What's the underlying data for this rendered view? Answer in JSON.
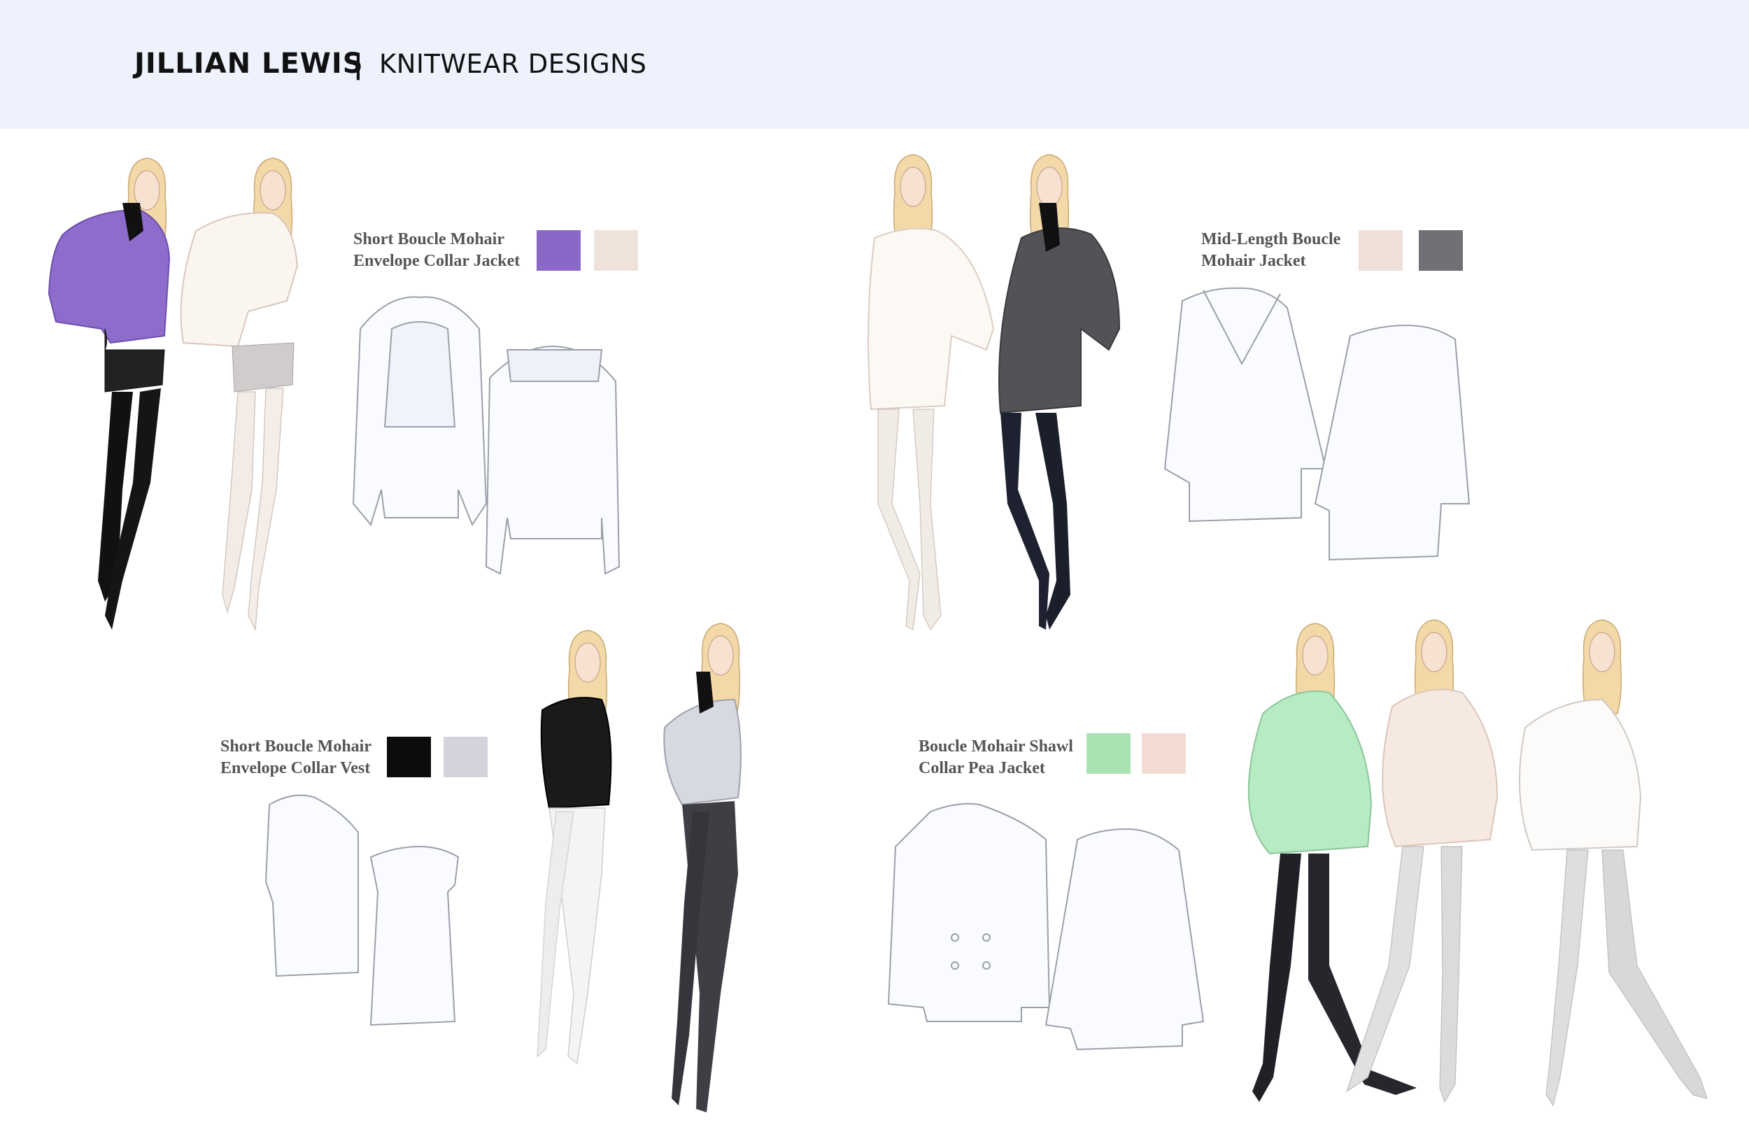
{
  "header": {
    "brand": "JILLIAN LEWIS",
    "separator": "|",
    "subtitle": "KNITWEAR DESIGNS"
  },
  "designs": [
    {
      "label_line1": "Short Boucle Mohair",
      "label_line2": "Envelope Collar Jacket",
      "swatches": [
        "#8a68c8",
        "#efe2db"
      ]
    },
    {
      "label_line1": "Mid-Length Boucle",
      "label_line2": "Mohair Jacket",
      "swatches": [
        "#eedfd9",
        "#717076"
      ]
    },
    {
      "label_line1": "Short Boucle Mohair",
      "label_line2": "Envelope Collar Vest",
      "swatches": [
        "#0c0c0c",
        "#d2d3dd"
      ]
    },
    {
      "label_line1": "Boucle Mohair Shawl",
      "label_line2": "Collar Pea Jacket",
      "swatches": [
        "#a8e1b2",
        "#f2dcd3"
      ]
    }
  ]
}
